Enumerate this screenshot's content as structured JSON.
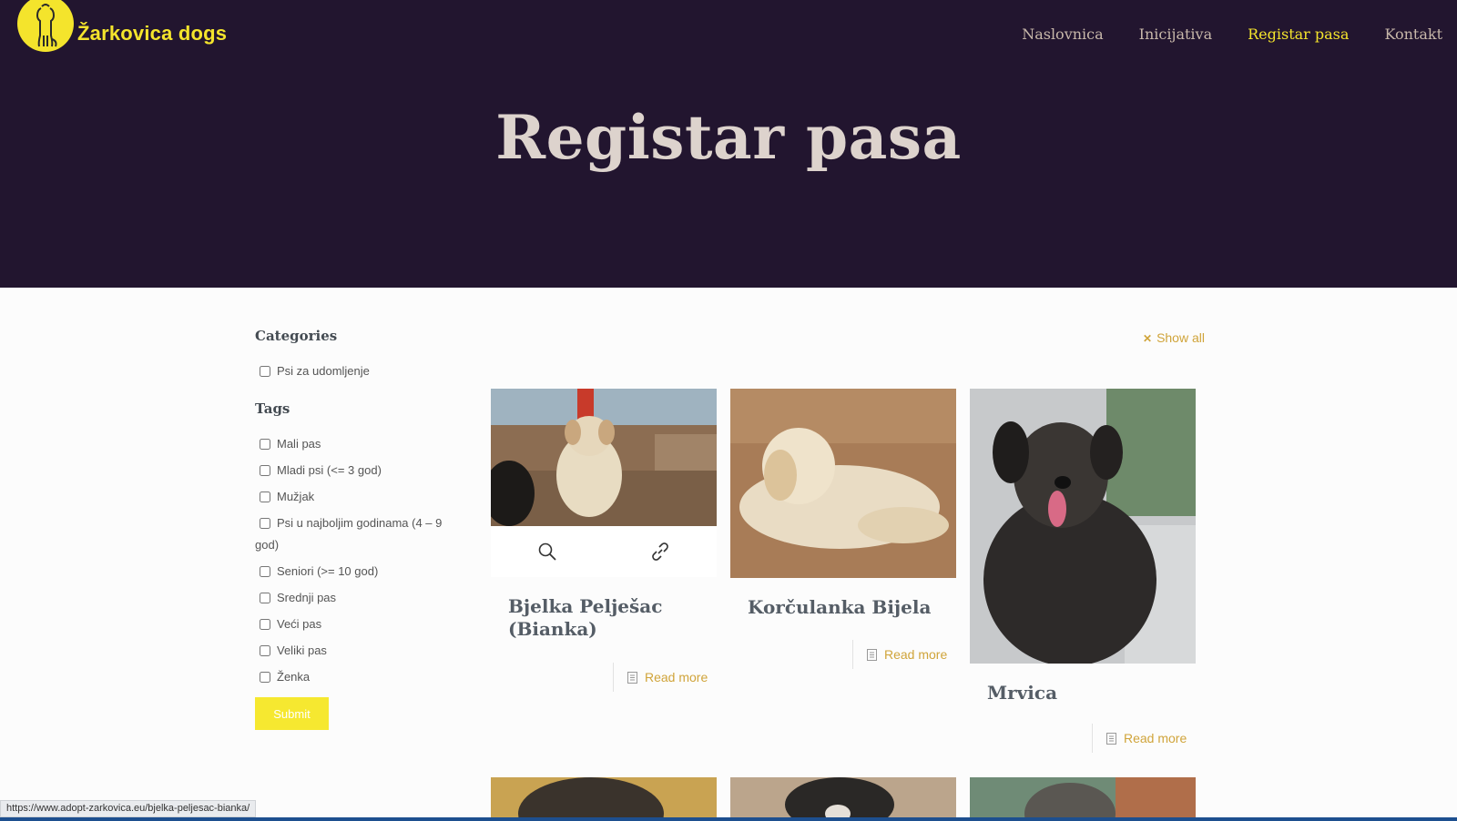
{
  "header": {
    "brand": "Žarkovica dogs",
    "logo_icon": "dog-silhouette-icon",
    "nav": [
      {
        "label": "Naslovnica",
        "active": false
      },
      {
        "label": "Inicijativa",
        "active": false
      },
      {
        "label": "Registar pasa",
        "active": true
      },
      {
        "label": "Kontakt",
        "active": false
      }
    ],
    "page_title": "Registar pasa"
  },
  "sidebar": {
    "categories_title": "Categories",
    "categories": [
      "Psi za udomljenje"
    ],
    "tags_title": "Tags",
    "tags": [
      "Mali pas",
      "Mladi psi (<= 3 god)",
      "Mužjak",
      "Psi u najboljim godinama (4 – 9 god)",
      "Seniori (>= 10 god)",
      "Srednji pas",
      "Veći pas",
      "Veliki pas",
      "Ženka"
    ],
    "submit_label": "Submit"
  },
  "show_all": "Show all",
  "cards": [
    {
      "title": "Bjelka Pelješac (Bianka)",
      "read_more": "Read more"
    },
    {
      "title": "Korčulanka Bijela",
      "read_more": "Read more"
    },
    {
      "title": "Mrvica",
      "read_more": "Read more"
    }
  ],
  "status_url": "https://www.adopt-zarkovica.eu/bjelka-peljesac-bianka/",
  "colors": {
    "header_bg": "#22152f",
    "accent_yellow": "#f4e42c",
    "link_gold": "#d0a43a"
  }
}
